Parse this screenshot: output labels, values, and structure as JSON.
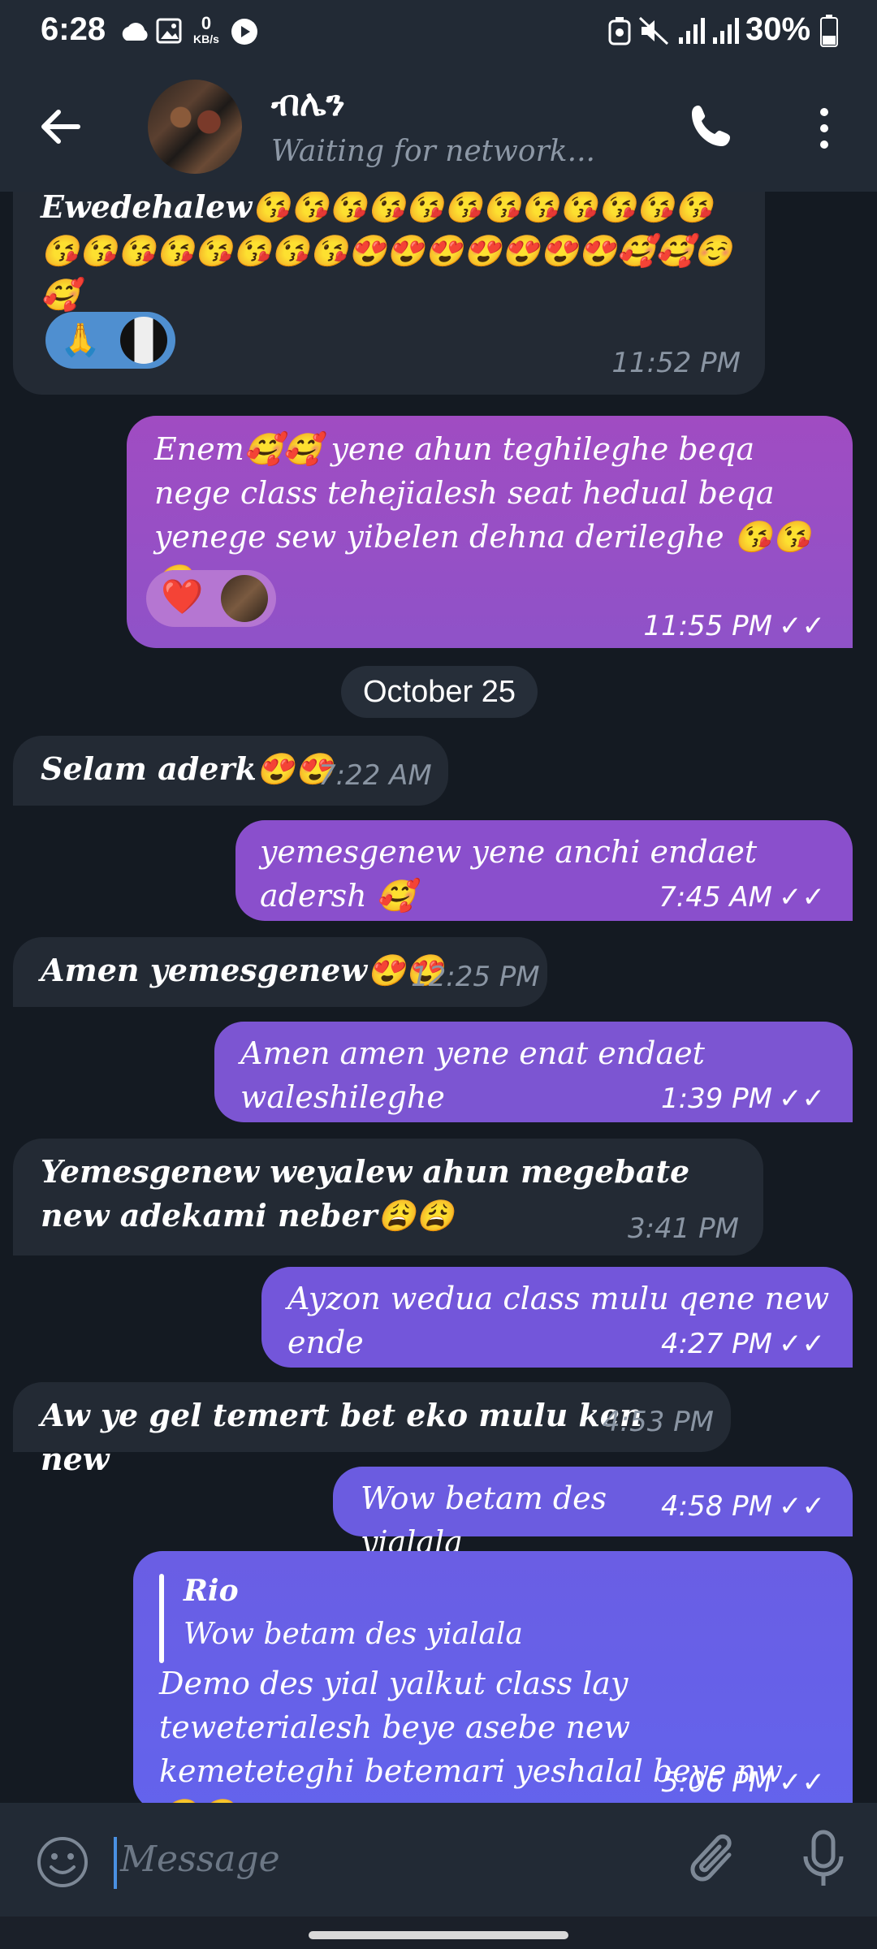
{
  "status_bar": {
    "time": "6:28",
    "kbs_value": "0",
    "kbs_unit": "KB/s",
    "battery": "30%"
  },
  "header": {
    "name": "ብሌን",
    "status": "Waiting for network..."
  },
  "messages": [
    {
      "dir": "in",
      "text": "Ewedehalew😘😘😘😘😘😘😘😘😘😘😘😘😘😘😘😘😘😘😘😘😍😍😍😍😍😍😍🥰🥰☺️🥰",
      "time": "11:52 PM",
      "reaction": "🙏"
    },
    {
      "dir": "out",
      "text": "Enem🥰🥰 yene ahun teghileghe beqa nege class tehejialesh seat hedual beqa yenege sew yibelen dehna derileghe 😘😘😘",
      "time": "11:55 PM",
      "reaction": "❤️"
    },
    {
      "dir": "in",
      "text": "Selam aderk😍😍",
      "time": "7:22 AM"
    },
    {
      "dir": "out",
      "text": "yemesgenew yene anchi endaet adersh 🥰",
      "time": "7:45 AM"
    },
    {
      "dir": "in",
      "text": "Amen yemesgenew😍😍",
      "time": "12:25 PM"
    },
    {
      "dir": "out",
      "text": "Amen amen yene enat endaet waleshileghe",
      "time": "1:39 PM"
    },
    {
      "dir": "in",
      "text": "Yemesgenew weyalew ahun megebate new adekami neber😩😩",
      "time": "3:41 PM"
    },
    {
      "dir": "out",
      "text": "Ayzon wedua class mulu qene new ende",
      "time": "4:27 PM"
    },
    {
      "dir": "in",
      "text": "Aw ye gel temert bet eko mulu ken new",
      "time": "4:53 PM"
    },
    {
      "dir": "out",
      "text": "Wow betam des yialala",
      "time": "4:58 PM"
    },
    {
      "dir": "out",
      "quote_name": "Rio",
      "quote_text": "Wow betam des yialala",
      "text": "Demo des yial yalkut class lay teweterialesh beye asebe new kemeteteghi betemari yeshalal beye nw 😒😒",
      "time": "5:06 PM"
    }
  ],
  "date_separator": "October 25",
  "ticks": "✓✓",
  "input": {
    "placeholder": "Message"
  },
  "colors": {
    "outgoing_gradient_top": "#9d4fc4",
    "outgoing_gradient_bottom": "#6a65e8",
    "incoming": "#232a34",
    "header": "#222a35"
  }
}
